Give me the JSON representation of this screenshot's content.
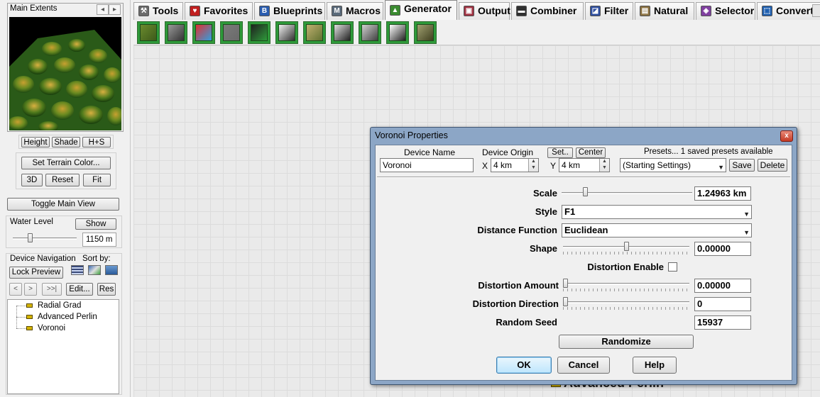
{
  "left_panel": {
    "main_extents": {
      "title": "Main Extents",
      "prev": "◂",
      "next": "▸"
    },
    "view_buttons": {
      "height": "Height",
      "shade": "Shade",
      "hs": "H+S"
    },
    "terrain_buttons": {
      "set_color": "Set Terrain Color...",
      "three_d": "3D",
      "reset": "Reset",
      "fit": "Fit"
    },
    "toggle_main_view": "Toggle Main View",
    "water": {
      "label": "Water Level",
      "show": "Show",
      "value": "1150 m",
      "level_fraction": 0.25
    },
    "device_nav": {
      "label": "Device Navigation",
      "sort_by": "Sort by:",
      "lock_preview": "Lock Preview",
      "back": "<",
      "forward": ">",
      "last": ">>|",
      "edit": "Edit...",
      "res": "Res",
      "tree": [
        "Radial Grad",
        "Advanced Perlin",
        "Voronoi"
      ]
    }
  },
  "tabs": [
    {
      "label": "Tools",
      "icon": "tools-icon",
      "glyph": "⚒",
      "color": "#6a6a6a"
    },
    {
      "label": "Favorites",
      "icon": "heart-icon",
      "glyph": "♥",
      "color": "#c02020"
    },
    {
      "label": "Blueprints",
      "icon": "blueprint-icon",
      "glyph": "B",
      "color": "#2a5db0"
    },
    {
      "label": "Macros",
      "icon": "macro-icon",
      "glyph": "M",
      "color": "#5a6a7a"
    },
    {
      "label": "Generator",
      "icon": "generator-icon",
      "glyph": "▲",
      "color": "#3a8a30",
      "active": true
    },
    {
      "label": "Output",
      "icon": "output-icon",
      "glyph": "▣",
      "color": "#a03040"
    },
    {
      "label": "Combiner",
      "icon": "combiner-icon",
      "glyph": "▬",
      "color": "#303030"
    },
    {
      "label": "Filter",
      "icon": "filter-icon",
      "glyph": "◪",
      "color": "#3050a0"
    },
    {
      "label": "Natural",
      "icon": "natural-icon",
      "glyph": "▤",
      "color": "#8a7040"
    },
    {
      "label": "Selector",
      "icon": "selector-icon",
      "glyph": "◈",
      "color": "#8040a0"
    },
    {
      "label": "Converter",
      "icon": "converter-icon",
      "glyph": "⬚",
      "color": "#2060b0"
    }
  ],
  "generator_tools": [
    {
      "name": "terrain-gen-icon",
      "colors": [
        "#6b8a2e",
        "#3d5a1a"
      ]
    },
    {
      "name": "noise-gen-icon",
      "colors": [
        "#999999",
        "#333333"
      ]
    },
    {
      "name": "color-gen-icon",
      "colors": [
        "#e03030",
        "#30a0e0"
      ]
    },
    {
      "name": "constant-gen-icon",
      "colors": [
        "#7a7a7a",
        "#6a6a6a"
      ]
    },
    {
      "name": "file-input-icon",
      "colors": [
        "#202020",
        "#2e9a3a"
      ]
    },
    {
      "name": "gradient-gen-icon",
      "colors": [
        "#f0f0f0",
        "#303030"
      ]
    },
    {
      "name": "tile-gen-icon",
      "colors": [
        "#c0b070",
        "#607030"
      ]
    },
    {
      "name": "cubes-gen-icon",
      "colors": [
        "#e0e0e0",
        "#202020"
      ]
    },
    {
      "name": "dome-gen-icon",
      "colors": [
        "#d0d0d0",
        "#404040"
      ]
    },
    {
      "name": "grid-gen-icon",
      "colors": [
        "#ffffff",
        "#202020"
      ]
    },
    {
      "name": "voronoi-gen-icon",
      "colors": [
        "#a0a070",
        "#404020"
      ]
    }
  ],
  "canvas": {
    "node_label": "Advanced Perlin"
  },
  "dialog": {
    "title": "Voronoi Properties",
    "close": "x",
    "device_name_label": "Device Name",
    "device_name": "Voronoi",
    "device_origin_label": "Device Origin",
    "x_label": "X",
    "x_value": "4 km",
    "y_label": "Y",
    "y_value": "4 km",
    "set_button": "Set..",
    "center_button": "Center",
    "presets_label": "Presets... 1 saved presets available",
    "preset_value": "(Starting Settings)",
    "save_button": "Save",
    "delete_button": "Delete",
    "scale_label": "Scale",
    "scale_value": "1.24963 km",
    "scale_fraction": 0.17,
    "style_label": "Style",
    "style_value": "F1",
    "distance_label": "Distance Function",
    "distance_value": "Euclidean",
    "shape_label": "Shape",
    "shape_value": "0.00000",
    "shape_fraction": 0.5,
    "distortion_enable_label": "Distortion Enable",
    "distortion_enable": false,
    "distortion_amount_label": "Distortion Amount",
    "distortion_amount_value": "0.00000",
    "distortion_amount_fraction": 0,
    "distortion_direction_label": "Distortion Direction",
    "distortion_direction_value": "0",
    "distortion_direction_fraction": 0,
    "seed_label": "Random Seed",
    "seed_value": "15937",
    "randomize_button": "Randomize",
    "ok_button": "OK",
    "cancel_button": "Cancel",
    "help_button": "Help"
  }
}
